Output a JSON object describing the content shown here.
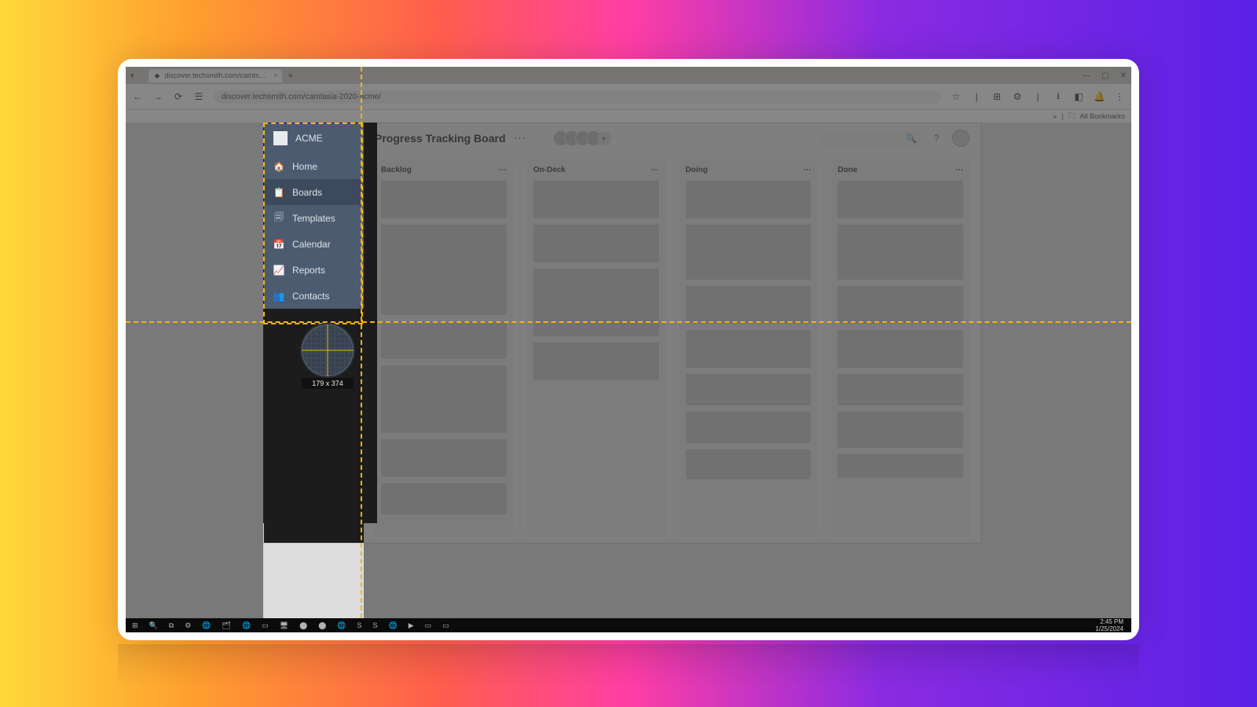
{
  "browser": {
    "tab_title": "discover.techsmith.com/camts…",
    "tab_close": "×",
    "new_tab": "+",
    "win_min": "—",
    "win_max": "▢",
    "win_close": "✕",
    "back": "←",
    "fwd": "→",
    "reload": "⟳",
    "url": "discover.techsmith.com/camtasia-2020-acme/",
    "star": "☆",
    "ext": "⊞",
    "puzzle": "⚙",
    "dl": "⭳",
    "panel": "◧",
    "bell": "🔔",
    "menu": "⋮",
    "bm_more": "»",
    "bm_folder": "🗀",
    "bm_all": "All Bookmarks"
  },
  "sidebar": {
    "org": "ACME",
    "items": [
      {
        "icon": "🏠",
        "label": "Home"
      },
      {
        "icon": "📋",
        "label": "Boards"
      },
      {
        "icon": "🗐",
        "label": "Templates"
      },
      {
        "icon": "📅",
        "label": "Calendar"
      },
      {
        "icon": "📈",
        "label": "Reports"
      },
      {
        "icon": "👥",
        "label": "Contacts"
      }
    ],
    "active_index": 1
  },
  "board": {
    "title": "Progress Tracking Board",
    "title_dots": "⋯",
    "columns": [
      {
        "name": "Backlog",
        "cards": [
          48,
          115,
          48,
          86,
          48,
          40
        ]
      },
      {
        "name": "On-Deck",
        "cards": [
          48,
          48,
          86,
          48
        ]
      },
      {
        "name": "Doing",
        "cards": [
          48,
          70,
          48,
          48,
          40,
          40,
          38
        ]
      },
      {
        "name": "Done",
        "cards": [
          48,
          70,
          48,
          48,
          40,
          46,
          30
        ]
      }
    ],
    "col_dots": "⋯",
    "help": "?",
    "add_av": "+"
  },
  "capture": {
    "dims": "179 x 374"
  },
  "taskbar": {
    "icons": [
      "⊞",
      "🔍",
      "⧉",
      "⚙",
      "🌐",
      "🗂",
      "🌐",
      "▭",
      "🖥",
      "⬤",
      "⬤",
      "🌐",
      "S",
      "S",
      "🌐",
      "▶",
      "▭",
      "▭"
    ],
    "time": "2:45 PM",
    "date": "1/25/2024"
  }
}
